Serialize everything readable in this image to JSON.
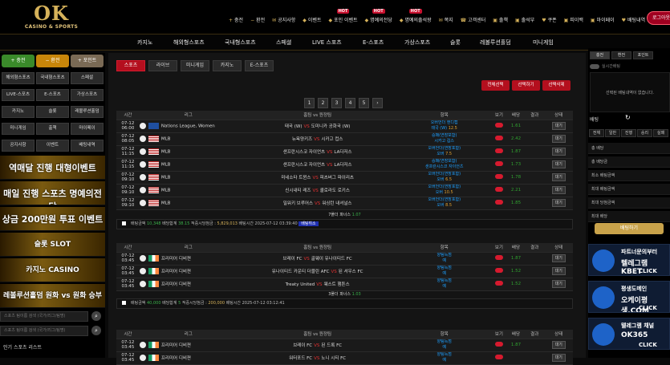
{
  "header": {
    "logo": "OK",
    "logo_sub": "CASINO & SPORTS",
    "logout": "로그아웃",
    "menu": [
      {
        "icon": "+",
        "label": "충전"
      },
      {
        "icon": "−",
        "label": "환전"
      },
      {
        "icon": "✉",
        "label": "공지사항"
      },
      {
        "icon": "◆",
        "label": "이벤트"
      },
      {
        "icon": "◆",
        "label": "포인 이벤트",
        "badge": "HOT"
      },
      {
        "icon": "◆",
        "label": "명예의전당",
        "badge": "HOT"
      },
      {
        "icon": "◆",
        "label": "명예의출석왕",
        "badge": "HOT"
      },
      {
        "icon": "✉",
        "label": "쪽지"
      },
      {
        "icon": "☎",
        "label": "고객센터"
      },
      {
        "icon": "▣",
        "label": "출책"
      },
      {
        "icon": "▣",
        "label": "출석부"
      },
      {
        "icon": "♥",
        "label": "쿠폰"
      },
      {
        "icon": "▣",
        "label": "피이백"
      },
      {
        "icon": "▣",
        "label": "마이페이"
      },
      {
        "icon": "♥",
        "label": "배팅내역"
      }
    ]
  },
  "mainnav": [
    "카지노",
    "해외형스포츠",
    "국내형스포츠",
    "스페셜",
    "LIVE 스포츠",
    "E-스포츠",
    "가상스포츠",
    "슬롯",
    "레볼루션홀덤",
    "미니게임"
  ],
  "left": {
    "buttons": [
      "+ 충전",
      "− 환전",
      "+ 포인트"
    ],
    "grid": [
      "해외형스포츠",
      "국내형스포츠",
      "스페셜",
      "LIVE-스포츠",
      "E-스포츠",
      "가상스포츠",
      "카지노",
      "슬롯",
      "레볼루션홀덤",
      "미니게임",
      "출책",
      "마이페이",
      "공지사항",
      "이벤트",
      "배팅내역"
    ],
    "banners": [
      "역매달 진행 대형이벤트",
      "매일 진행 스포츠 명예의전당",
      "상금 200만원 투표 이벤트",
      "슬롯 SLOT",
      "카지노 CASINO",
      "레볼루션홀덤 원화 vs 원화 승부"
    ],
    "search1": "스포츠 팀이름 검색 (국가/리그/팀명)",
    "search2": "스포츠 팀이름 검색 (국가/리그/팀명)",
    "popular": "인기 스포츠 리스트"
  },
  "center": {
    "tabs": [
      "스포츠",
      "라이브",
      "미니게임",
      "카지노",
      "E-스포츠"
    ],
    "actions": [
      "전체선택",
      "선택하기",
      "선택삭제"
    ],
    "pages": [
      "1",
      "2",
      "3",
      "4",
      "5",
      "›"
    ],
    "headers": [
      "시간",
      "리그",
      "홈팀 vs 원정팀",
      "항목",
      "보기",
      "배당",
      "결과",
      "상태"
    ],
    "table1": [
      {
        "date": "07-12",
        "time": "06:00",
        "flag": "vnl",
        "league": "Nations League, Women",
        "home": "태국 (W)",
        "away": "도미니카 공화국 (W)",
        "o1": "오버언더 핸디캡",
        "o2": "태국 (W)",
        "o3": "12.5",
        "odds": "1.61",
        "btn": "대기"
      },
      {
        "date": "07-12",
        "time": "08:05",
        "flag": "us",
        "league": "MLB",
        "home": "뉴욕양키즈",
        "away": "시카고 컵스",
        "o1": "승패(연장포함)",
        "o2": "시카고 컵스",
        "o3": "",
        "odds": "2.42",
        "btn": "대기"
      },
      {
        "date": "07-12",
        "time": "11:15",
        "flag": "us",
        "league": "MLB",
        "home": "샌프란시스코 자이언츠",
        "away": "LA다저스",
        "o1": "오버언더(연장포함)",
        "o2": "오버",
        "o3": "7.5",
        "odds": "1.87",
        "btn": "대기"
      },
      {
        "date": "07-12",
        "time": "11:15",
        "flag": "us",
        "league": "MLB",
        "home": "샌프란시스코 자이언츠",
        "away": "LA다저스",
        "o1": "승패(연장포함)",
        "o2": "샌프란시스코 자이언츠",
        "o3": "",
        "odds": "1.73",
        "btn": "대기"
      },
      {
        "date": "07-12",
        "time": "09:10",
        "flag": "us",
        "league": "MLB",
        "home": "미네소타 트윈스",
        "away": "피츠버그 파이리츠",
        "o1": "오버언더(연장포함)",
        "o2": "오버",
        "o3": "6.5",
        "odds": "1.78",
        "btn": "대기"
      },
      {
        "date": "07-12",
        "time": "09:10",
        "flag": "us",
        "league": "MLB",
        "home": "신시내티 레즈",
        "away": "콜로라도 로키스",
        "o1": "오버언더(연장포함)",
        "o2": "오버",
        "o3": "10.5",
        "odds": "2.21",
        "btn": "대기"
      },
      {
        "date": "07-12",
        "time": "09:10",
        "flag": "us",
        "league": "MLB",
        "home": "밀워키 브루어스",
        "away": "워싱턴 내셔널스",
        "o1": "오버언더(연장포함)",
        "o2": "오버",
        "o3": "8.5",
        "odds": "1.85",
        "btn": "대기"
      }
    ],
    "folder1": {
      "text": "7폴더 파너스",
      "value": "1.07"
    },
    "foot1": {
      "a": "배팅금액",
      "a_v": "10,348",
      "b": "배당합계",
      "b_v": "38.15",
      "c": "적중시당첨금 :",
      "c_v": "5,829,013",
      "d": "배팅시간 2025-07-12 03:39:40",
      "cancel": "배팅취소"
    },
    "table2": [
      {
        "date": "07-12",
        "time": "03:45",
        "flag": "ie",
        "league": "프리미어 디비젼",
        "home": "브레이 FC",
        "away": "골웨이 유나이티드 FC",
        "o1": "양팀득점",
        "o2": "예",
        "o3": "",
        "odds": "1.87",
        "btn": "대기"
      },
      {
        "date": "07-12",
        "time": "03:45",
        "flag": "ie",
        "league": "프리미어 디비젼",
        "home": "유나이티드 카운티 더블린 AFC",
        "away": "된 셔우스 FC",
        "o1": "양팀득점",
        "o2": "예",
        "o3": "",
        "odds": "1.52",
        "btn": "대기"
      },
      {
        "date": "07-12",
        "time": "03:45",
        "flag": "ie",
        "league": "프리미어 디비젼",
        "home": "Treaty United",
        "away": "웨스트 햄튼스",
        "o1": "양팀득점",
        "o2": "예",
        "o3": "",
        "odds": "1.52",
        "btn": "대기"
      }
    ],
    "folder2": {
      "text": "3폴더 파너스",
      "value": "1.03"
    },
    "foot2": {
      "a": "배팅금액",
      "a_v": "40,000",
      "b": "배당합계",
      "b_v": "5",
      "c": "적중시당첨금 :",
      "c_v": "200,000",
      "d": "배팅시간 2025-07-12 03:12:41",
      "cancel": ""
    },
    "table3": [
      {
        "date": "07-12",
        "time": "03:45",
        "flag": "ie",
        "league": "프리미어 디비젼",
        "home": "브레이 FC",
        "away": "된 드록 FC",
        "o1": "양팀득점",
        "o2": "예",
        "o3": "",
        "odds": "1.87",
        "btn": "대기"
      },
      {
        "date": "07-12",
        "time": "03:45",
        "flag": "ie",
        "league": "프리미어 디비젼",
        "home": "워터포드 FC",
        "away": "노니 시티 FC",
        "o1": "양팀득점",
        "o2": "예",
        "o3": "",
        "odds": "",
        "btn": "대기"
      }
    ]
  },
  "right": {
    "tabs": [
      "충전",
      "환전",
      "포인트"
    ],
    "realtime": "실시간배팅",
    "notice": "선택된 배팅내역이 없습니다.",
    "bet": "배팅",
    "refresh": "↻",
    "filters": [
      "전체",
      "일반",
      "진행",
      "승리",
      "실패"
    ],
    "rows": [
      "총 배당",
      "총 배당금",
      "최소 배팅금액",
      "최대 배팅금액",
      "최대 당첨금액",
      "최대 배당"
    ],
    "betbtn": "배팅하기",
    "banners": [
      {
        "t1": "파트너문의부터",
        "t2": "텔레그램 KBET",
        "t3": "CLICK"
      },
      {
        "t1": "평생도메인",
        "t2": "오케이평생.COM",
        "t3": "CLICK"
      },
      {
        "t1": "텔레그램 채널",
        "t2": "OK365",
        "t3": "CLICK"
      }
    ]
  },
  "colors": {
    "gold": "#d6b25a",
    "red": "#b40f1e",
    "odds_blue": "#1ea0ff",
    "value_green": "#30a030"
  }
}
